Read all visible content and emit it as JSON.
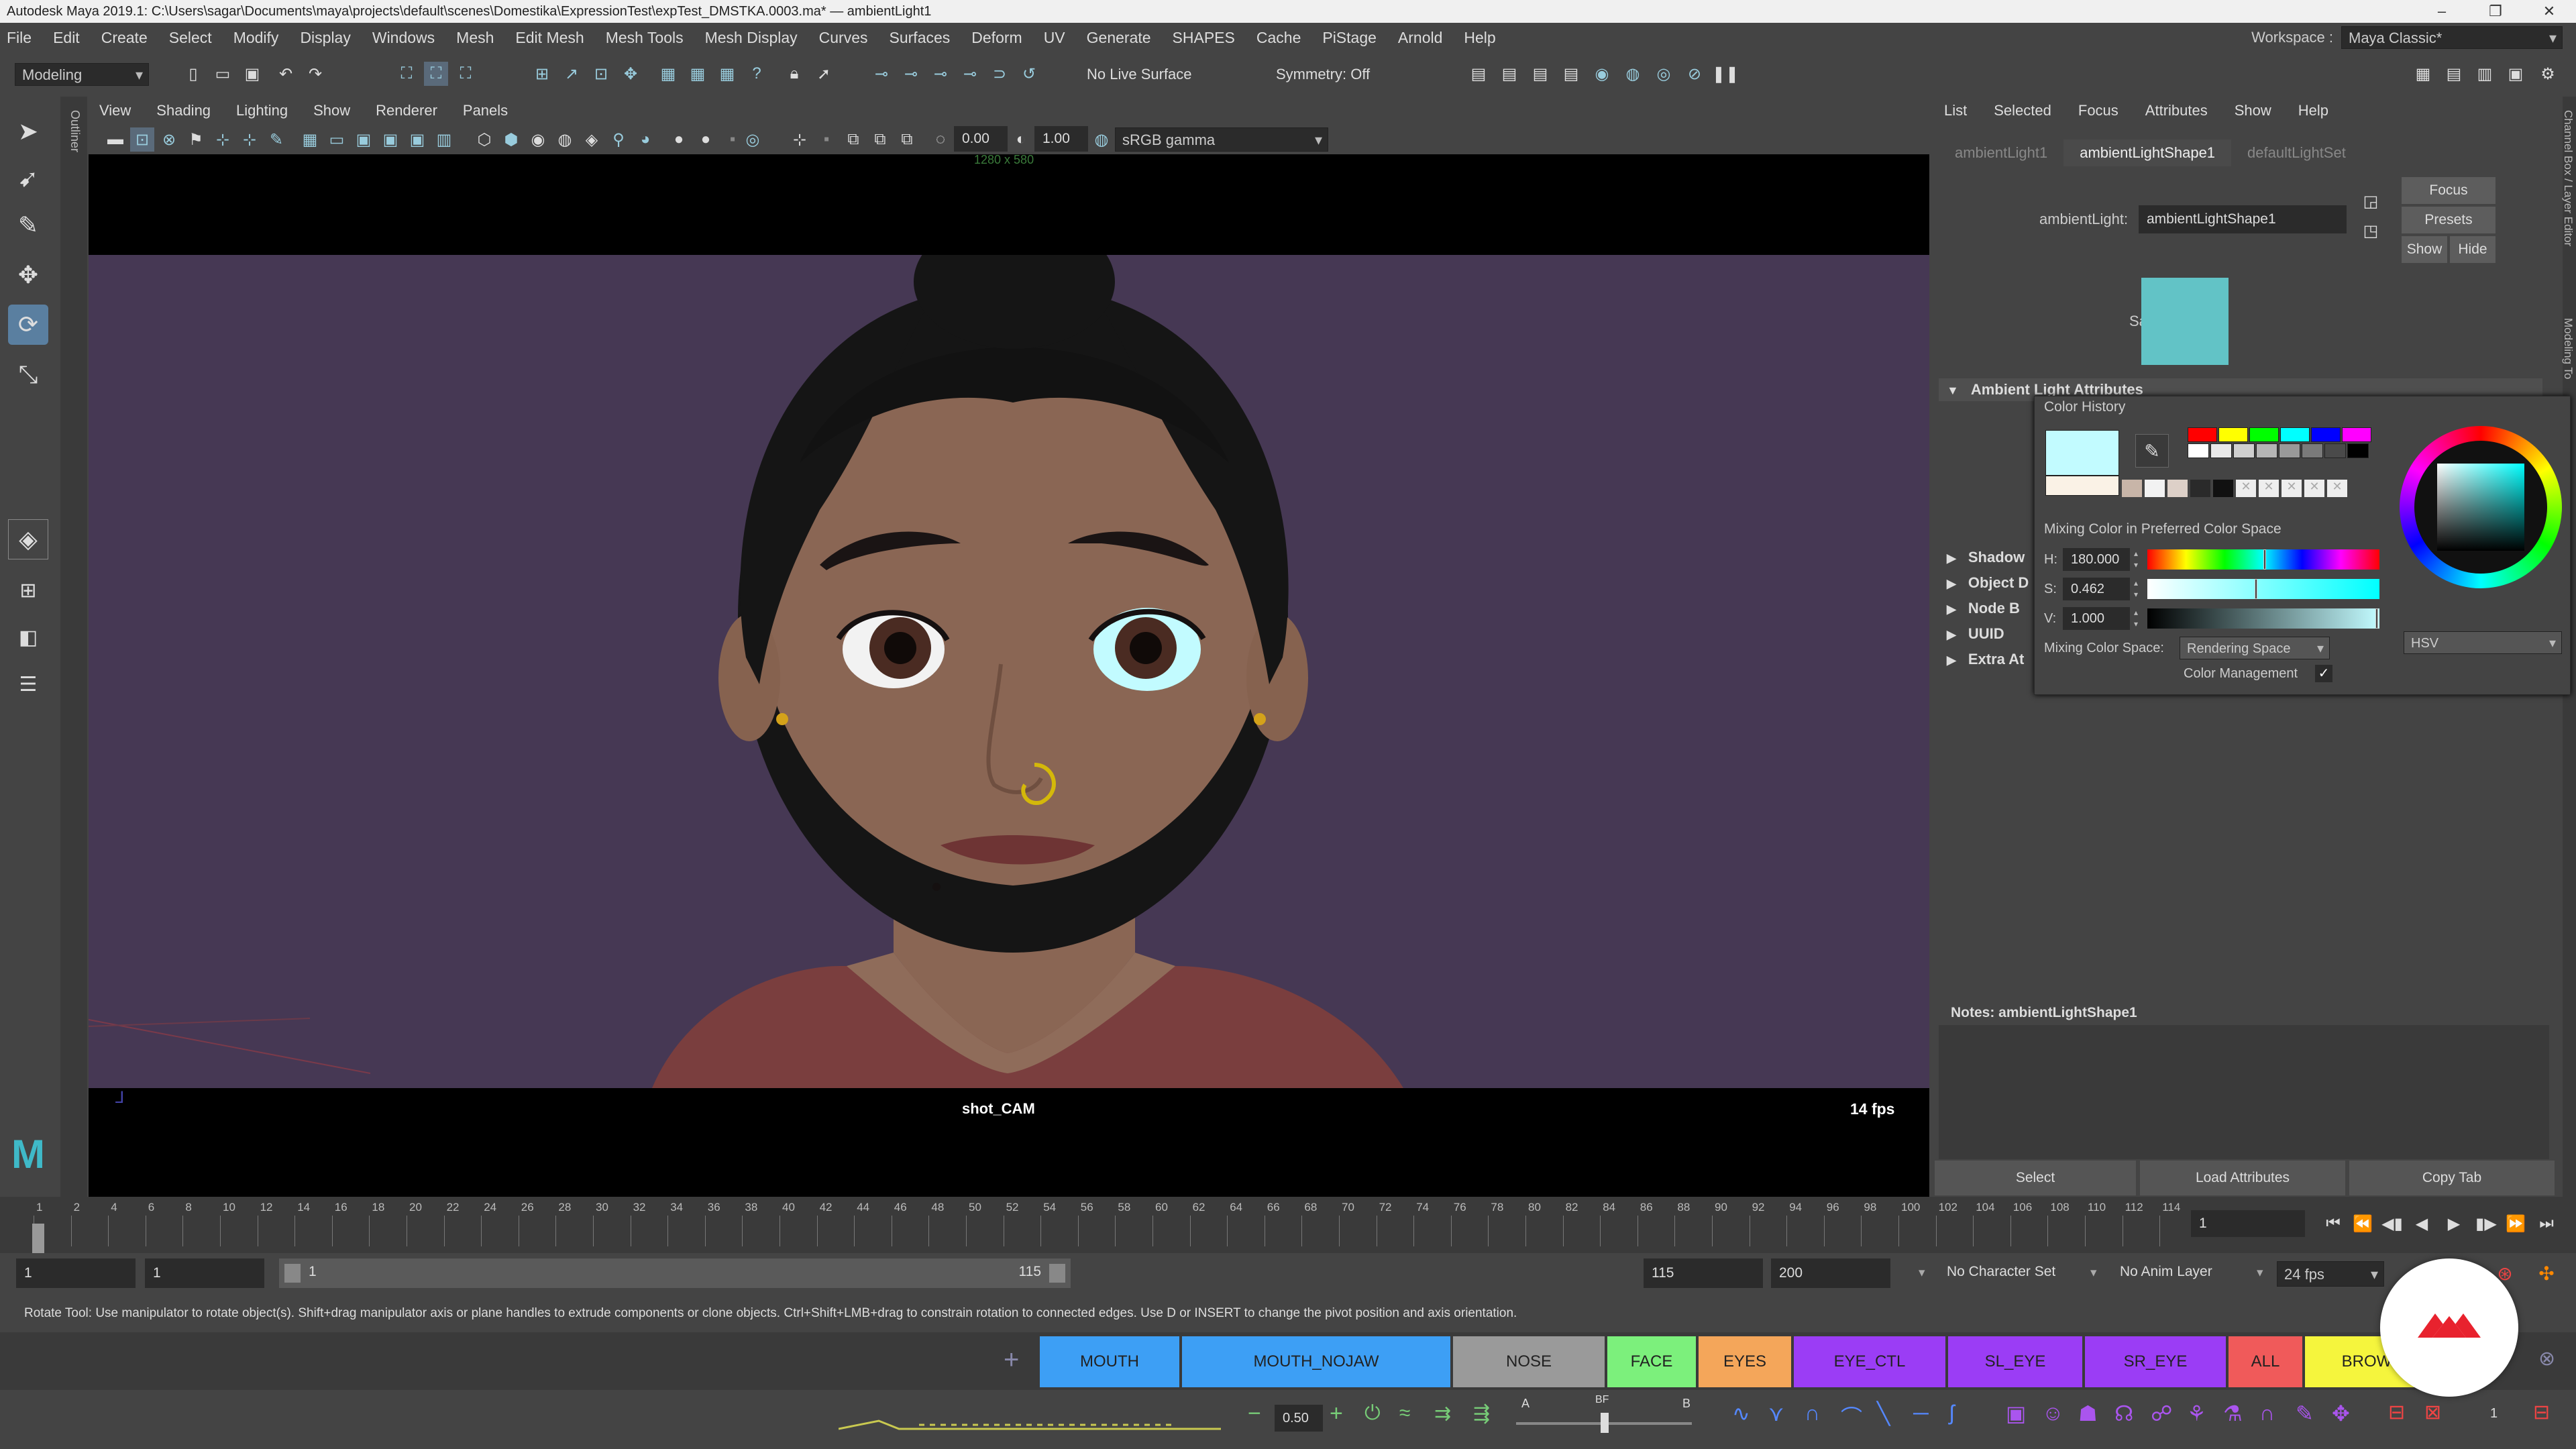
{
  "window": {
    "title": "Autodesk Maya 2019.1: C:\\Users\\sagar\\Documents\\maya\\projects\\default\\scenes\\Domestika\\ExpressionTest\\expTest_DMSTKA.0003.ma* — ambientLight1",
    "controls": [
      "–",
      "❐",
      "✕"
    ]
  },
  "menubar": {
    "items": [
      "File",
      "Edit",
      "Create",
      "Select",
      "Modify",
      "Display",
      "Windows",
      "Mesh",
      "Edit Mesh",
      "Mesh Tools",
      "Mesh Display",
      "Curves",
      "Surfaces",
      "Deform",
      "UV",
      "Generate",
      "SHAPES",
      "Cache",
      "PiStage",
      "Arnold",
      "Help"
    ],
    "workspace_label": "Workspace :",
    "workspace_value": "Maya Classic*"
  },
  "statusline": {
    "mode": "Modeling",
    "live_surface": "No Live Surface",
    "symmetry": "Symmetry: Off"
  },
  "outliner_tab": "Outliner",
  "viewport": {
    "menu": [
      "View",
      "Shading",
      "Lighting",
      "Show",
      "Renderer",
      "Panels"
    ],
    "exposure": "0.00",
    "gamma": "1.00",
    "color_space": "sRGB gamma",
    "resolution": "1280 x 580",
    "camera": "shot_CAM",
    "fps": "14 fps",
    "colors": {
      "background": "#463854",
      "letterbox": "#000000",
      "skin": "#8a6654",
      "hair": "#1a1a1a"
    }
  },
  "attribute_editor": {
    "menu": [
      "List",
      "Selected",
      "Focus",
      "Attributes",
      "Show",
      "Help"
    ],
    "tabs": [
      "ambientLight1",
      "ambientLightShape1",
      "defaultLightSet"
    ],
    "active_tab": 1,
    "node_label": "ambientLight:",
    "node_value": "ambientLightShape1",
    "focus_button": "Focus",
    "presets_button": "Presets",
    "show_button": "Show",
    "hide_button": "Hide",
    "sample_label": "Sample",
    "sample_color": "#62c3c6",
    "sections": [
      "Ambient Light Attributes",
      "Shadow",
      "Object D",
      "Node B",
      "UUID",
      "Extra At"
    ],
    "notes_label": "Notes:  ambientLightShape1",
    "bottom_buttons": [
      "Select",
      "Load Attributes",
      "Copy Tab"
    ],
    "side_tabs": [
      "Channel Box / Layer Editor",
      "Modeling To"
    ]
  },
  "color_picker": {
    "history_label": "Color History",
    "current_color": "#c2fbff",
    "previous_color": "#faf2e6",
    "mixing_label": "Mixing Color in Preferred Color Space",
    "h_label": "H:",
    "h_value": "180.000",
    "s_label": "S:",
    "s_value": "0.462",
    "v_label": "V:",
    "v_value": "1.000",
    "s_fraction": 0.462,
    "h_fraction": 0.5,
    "v_fraction": 1.0,
    "mixing_space_label": "Mixing Color Space:",
    "mixing_space_value": "Rendering Space",
    "cm_label": "Color Management",
    "mode": "HSV",
    "swatches_row1": [
      "#ff0000",
      "#ffff00",
      "#00ff00",
      "#00ffff",
      "#0000ff",
      "#ff00ff"
    ],
    "swatches_row2": [
      "#ffffff",
      "#e8e8e8",
      "#cfcfcf",
      "#b5b5b5",
      "#999999",
      "#7a7a7a",
      "#4a4a4a",
      "#000000"
    ]
  },
  "timeline": {
    "ticks": [
      "1",
      "2",
      "4",
      "6",
      "8",
      "10",
      "12",
      "14",
      "16",
      "18",
      "20",
      "22",
      "24",
      "26",
      "28",
      "30",
      "32",
      "34",
      "36",
      "38",
      "40",
      "42",
      "44",
      "46",
      "48",
      "50",
      "52",
      "54",
      "56",
      "58",
      "60",
      "62",
      "64",
      "66",
      "68",
      "70",
      "72",
      "74",
      "76",
      "78",
      "80",
      "82",
      "84",
      "86",
      "88",
      "90",
      "92",
      "94",
      "96",
      "98",
      "100",
      "102",
      "104",
      "106",
      "108",
      "110",
      "112",
      "114"
    ],
    "current_frame": "1"
  },
  "range": {
    "start": "1",
    "anim_start": "1",
    "range_start": "1",
    "range_end": "115",
    "anim_end": "115",
    "end": "200",
    "character_set": "No Character Set",
    "anim_layer": "No Anim Layer",
    "fps": "24 fps"
  },
  "help_line": "Rotate Tool: Use manipulator to rotate object(s). Shift+drag manipulator axis or plane handles to extrude components or clone objects. Ctrl+Shift+LMB+drag to constrain rotation to connected edges. Use D or INSERT to change the pivot position and axis orientation.",
  "shelf": {
    "buttons": [
      {
        "label": "MOUTH",
        "color": "#3d9ff5"
      },
      {
        "label": "MOUTH_NOJAW",
        "color": "#3d9ff5"
      },
      {
        "label": "NOSE",
        "color": "#9a9a9a"
      },
      {
        "label": "FACE",
        "color": "#7cf07c"
      },
      {
        "label": "EYES",
        "color": "#f4a65a"
      },
      {
        "label": "EYE_CTL",
        "color": "#9b3df5"
      },
      {
        "label": "SL_EYE",
        "color": "#9b3df5"
      },
      {
        "label": "SR_EYE",
        "color": "#9b3df5"
      },
      {
        "label": "ALL",
        "color": "#f05a5a"
      },
      {
        "label": "BROWS",
        "color": "#f5f53d"
      }
    ]
  },
  "bottom": {
    "weight": "0.50",
    "labels_a": "A",
    "labels_bf": "BF",
    "labels_b": "B",
    "right_num": "1"
  }
}
